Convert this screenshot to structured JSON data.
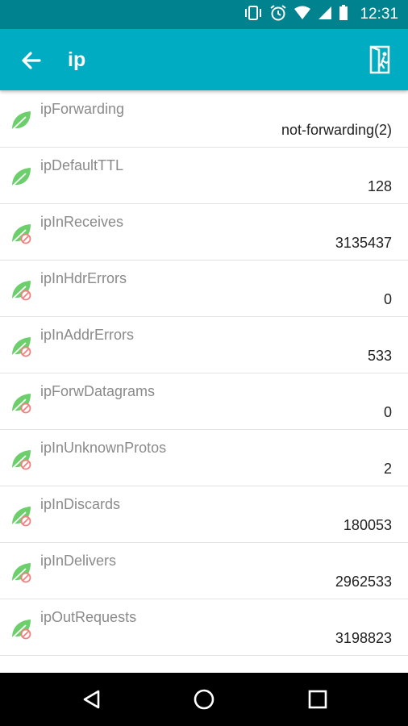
{
  "status_bar": {
    "time": "12:31",
    "icons": [
      "vibrate-icon",
      "alarm-icon",
      "wifi-icon",
      "signal-icon",
      "battery-icon"
    ]
  },
  "app_bar": {
    "title": "ip",
    "back_icon": "arrow-left-icon",
    "exit_icon": "exit-icon"
  },
  "items": [
    {
      "name": "ipForwarding",
      "value": "not-forwarding(2)",
      "icon": "leaf-icon"
    },
    {
      "name": "ipDefaultTTL",
      "value": "128",
      "icon": "leaf-icon"
    },
    {
      "name": "ipInReceives",
      "value": "3135437",
      "icon": "leaf-readonly-icon"
    },
    {
      "name": "ipInHdrErrors",
      "value": "0",
      "icon": "leaf-readonly-icon"
    },
    {
      "name": "ipInAddrErrors",
      "value": "533",
      "icon": "leaf-readonly-icon"
    },
    {
      "name": "ipForwDatagrams",
      "value": "0",
      "icon": "leaf-readonly-icon"
    },
    {
      "name": "ipInUnknownProtos",
      "value": "2",
      "icon": "leaf-readonly-icon"
    },
    {
      "name": "ipInDiscards",
      "value": "180053",
      "icon": "leaf-readonly-icon"
    },
    {
      "name": "ipInDelivers",
      "value": "2962533",
      "icon": "leaf-readonly-icon"
    },
    {
      "name": "ipOutRequests",
      "value": "3198823",
      "icon": "leaf-readonly-icon"
    }
  ],
  "colors": {
    "status_bar": "#00838f",
    "app_bar": "#00acc1",
    "leaf": "#6ccf6c",
    "readonly_badge": "#f08080"
  },
  "nav_bar": {
    "icons": [
      "back-triangle-icon",
      "home-circle-icon",
      "recents-square-icon"
    ]
  }
}
